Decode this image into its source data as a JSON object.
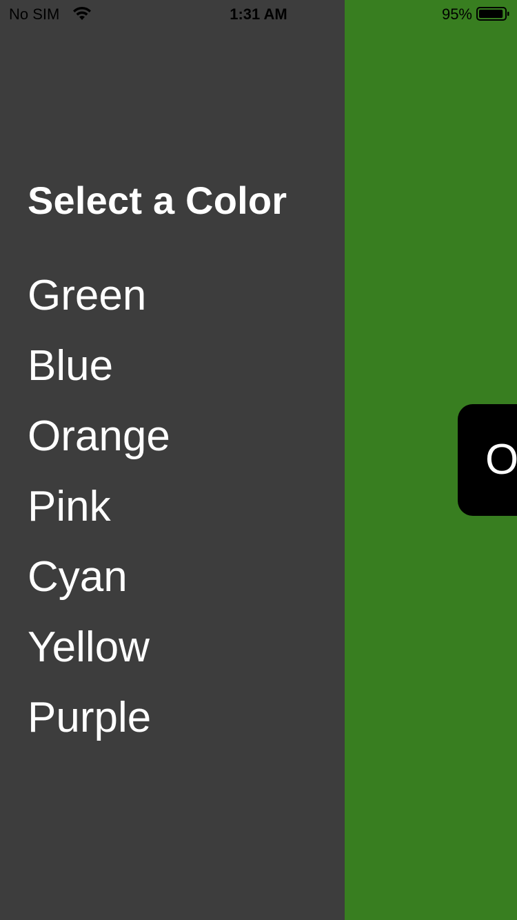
{
  "status_bar": {
    "carrier": "No SIM",
    "time": "1:31 AM",
    "battery_percent": "95%",
    "battery_level": 0.95,
    "wifi_icon": "wifi-icon",
    "battery_icon": "battery-icon"
  },
  "drawer": {
    "title": "Select a Color",
    "items": [
      {
        "label": "Green"
      },
      {
        "label": "Blue"
      },
      {
        "label": "Orange"
      },
      {
        "label": "Pink"
      },
      {
        "label": "Cyan"
      },
      {
        "label": "Yellow"
      },
      {
        "label": "Purple"
      }
    ]
  },
  "main": {
    "background_color": "#387e20",
    "toggle_label": "O"
  },
  "colors": {
    "drawer_background": "#3d3d3d",
    "text": "#ffffff",
    "button_background": "#000000"
  }
}
